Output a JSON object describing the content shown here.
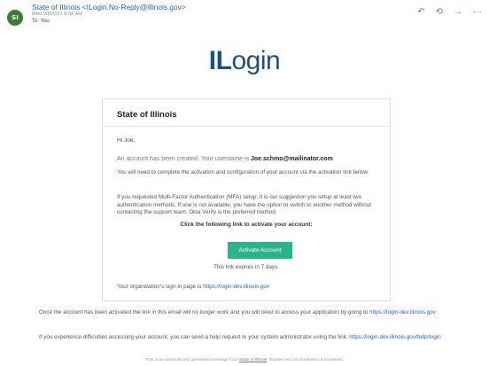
{
  "header": {
    "avatar_initials": "SI",
    "sender": "State of Illinois <ILogin.No-Reply@illinois.gov>",
    "date": "Wed 9/8/2021 8:42 AM",
    "to": "To: You",
    "actions": [
      {
        "name": "reply-icon",
        "glyph": "↶"
      },
      {
        "name": "reply-all-icon",
        "glyph": "⟲"
      },
      {
        "name": "forward-icon",
        "glyph": "→"
      },
      {
        "name": "more-icon",
        "glyph": "···"
      }
    ]
  },
  "logo": {
    "first": "IL",
    "rest": "ogin"
  },
  "card": {
    "title": "State of Illinois",
    "greeting": "Hi Joe,",
    "created_prefix": "An account has been created. Your username is ",
    "username": "Joe.schmo@mailinator.com",
    "complete_text": "You will need to complete the activation and configuration of your account via the activation link below.",
    "mfa_text": "If you requested Multi-Factor Authentication (MFA) setup, it is our suggestion you setup at least two authentication methods. If one is not available, you have the option to switch to another method without contacting the support team. Okta Verify is the preferred method.",
    "click_label": "Click the following link to activate your account:",
    "activate_button": "Activate Account",
    "expires": "This link expires in 7 days.",
    "signin_prefix": "Your organization's sign-in page is ",
    "signin_link": "https://login-dev.illinois.gov"
  },
  "footer": {
    "para1_text": "Once the account has been activated the link in this email will no longer work and you will need to access your application by going to ",
    "para1_link": "https://login-dev.illinois.gov",
    "para2_text": "If you experience difficulties accessing your account, you can send a help request to your system administrator using the link: ",
    "para2_link": "https://login-dev.illinois.gov/help/login",
    "auto_prefix": "This is an automatically generated message from ",
    "auto_org": "State of Illinois",
    "auto_suffix": ". Replies are not monitored or answered."
  },
  "colors": {
    "link": "#2b63b5",
    "button": "#2bb48c",
    "avatar": "#3d7c3a",
    "logo": "#1f4f8a"
  }
}
